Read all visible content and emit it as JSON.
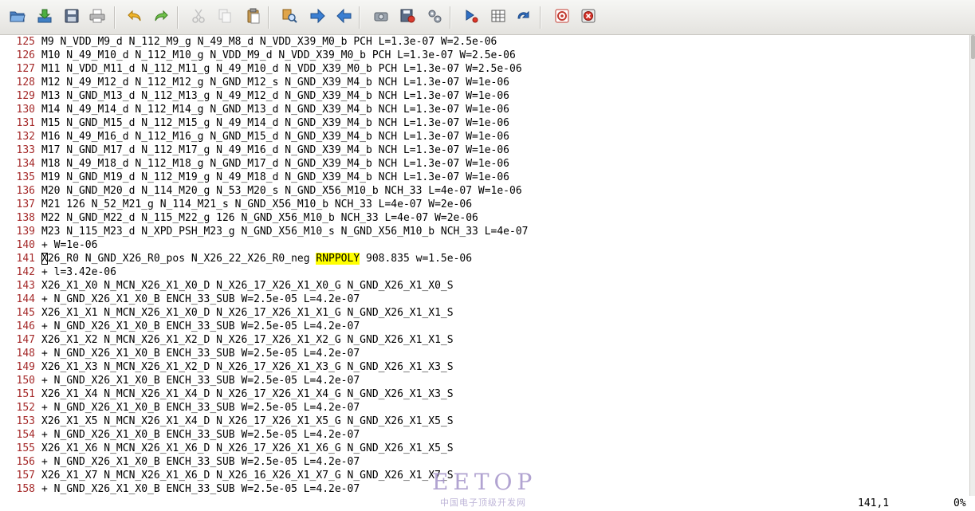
{
  "toolbar": {
    "buttons": [
      {
        "name": "open-folder-icon"
      },
      {
        "name": "download-icon"
      },
      {
        "name": "save-icon"
      },
      {
        "name": "print-icon"
      },
      {
        "name": "undo-icon"
      },
      {
        "name": "redo-icon"
      },
      {
        "name": "cut-icon"
      },
      {
        "name": "copy-icon"
      },
      {
        "name": "paste-icon"
      },
      {
        "name": "find-replace-icon"
      },
      {
        "name": "arrow-right-icon"
      },
      {
        "name": "arrow-left-icon"
      },
      {
        "name": "build-icon"
      },
      {
        "name": "save-session-icon"
      },
      {
        "name": "settings-icon"
      },
      {
        "name": "run-icon"
      },
      {
        "name": "table-icon"
      },
      {
        "name": "redo-arrow-icon"
      },
      {
        "name": "help-icon"
      },
      {
        "name": "close-window-icon"
      }
    ]
  },
  "editor": {
    "lines": [
      {
        "num": "125",
        "text": "M9 N_VDD_M9_d N_112_M9_g N_49_M8_d N_VDD_X39_M0_b PCH L=1.3e-07 W=2.5e-06"
      },
      {
        "num": "126",
        "text": "M10 N_49_M10_d N_112_M10_g N_VDD_M9_d N_VDD_X39_M0_b PCH L=1.3e-07 W=2.5e-06"
      },
      {
        "num": "127",
        "text": "M11 N_VDD_M11_d N_112_M11_g N_49_M10_d N_VDD_X39_M0_b PCH L=1.3e-07 W=2.5e-06"
      },
      {
        "num": "128",
        "text": "M12 N_49_M12_d N_112_M12_g N_GND_M12_s N_GND_X39_M4_b NCH L=1.3e-07 W=1e-06"
      },
      {
        "num": "129",
        "text": "M13 N_GND_M13_d N_112_M13_g N_49_M12_d N_GND_X39_M4_b NCH L=1.3e-07 W=1e-06"
      },
      {
        "num": "130",
        "text": "M14 N_49_M14_d N_112_M14_g N_GND_M13_d N_GND_X39_M4_b NCH L=1.3e-07 W=1e-06"
      },
      {
        "num": "131",
        "text": "M15 N_GND_M15_d N_112_M15_g N_49_M14_d N_GND_X39_M4_b NCH L=1.3e-07 W=1e-06"
      },
      {
        "num": "132",
        "text": "M16 N_49_M16_d N_112_M16_g N_GND_M15_d N_GND_X39_M4_b NCH L=1.3e-07 W=1e-06"
      },
      {
        "num": "133",
        "text": "M17 N_GND_M17_d N_112_M17_g N_49_M16_d N_GND_X39_M4_b NCH L=1.3e-07 W=1e-06"
      },
      {
        "num": "134",
        "text": "M18 N_49_M18_d N_112_M18_g N_GND_M17_d N_GND_X39_M4_b NCH L=1.3e-07 W=1e-06"
      },
      {
        "num": "135",
        "text": "M19 N_GND_M19_d N_112_M19_g N_49_M18_d N_GND_X39_M4_b NCH L=1.3e-07 W=1e-06"
      },
      {
        "num": "136",
        "text": "M20 N_GND_M20_d N_114_M20_g N_53_M20_s N_GND_X56_M10_b NCH_33 L=4e-07 W=1e-06"
      },
      {
        "num": "137",
        "text": "M21 126 N_52_M21_g N_114_M21_s N_GND_X56_M10_b NCH_33 L=4e-07 W=2e-06"
      },
      {
        "num": "138",
        "text": "M22 N_GND_M22_d N_115_M22_g 126 N_GND_X56_M10_b NCH_33 L=4e-07 W=2e-06"
      },
      {
        "num": "139",
        "text": "M23 N_115_M23_d N_XPD_PSH_M23_g N_GND_X56_M10_s N_GND_X56_M10_b NCH_33 L=4e-07"
      },
      {
        "num": "140",
        "text": "+ W=1e-06"
      },
      {
        "num": "141",
        "cursor": "X",
        "text": "26_R0 N_GND_X26_R0_pos N_X26_22_X26_R0_neg ",
        "highlight": "RNPPOLY",
        "after": " 908.835 w=1.5e-06"
      },
      {
        "num": "142",
        "text": "+ l=3.42e-06"
      },
      {
        "num": "143",
        "text": "X26_X1_X0 N_MCN_X26_X1_X0_D N_X26_17_X26_X1_X0_G N_GND_X26_X1_X0_S"
      },
      {
        "num": "144",
        "text": "+ N_GND_X26_X1_X0_B ENCH_33_SUB W=2.5e-05 L=4.2e-07"
      },
      {
        "num": "145",
        "text": "X26_X1_X1 N_MCN_X26_X1_X0_D N_X26_17_X26_X1_X1_G N_GND_X26_X1_X1_S"
      },
      {
        "num": "146",
        "text": "+ N_GND_X26_X1_X0_B ENCH_33_SUB W=2.5e-05 L=4.2e-07"
      },
      {
        "num": "147",
        "text": "X26_X1_X2 N_MCN_X26_X1_X2_D N_X26_17_X26_X1_X2_G N_GND_X26_X1_X1_S"
      },
      {
        "num": "148",
        "text": "+ N_GND_X26_X1_X0_B ENCH_33_SUB W=2.5e-05 L=4.2e-07"
      },
      {
        "num": "149",
        "text": "X26_X1_X3 N_MCN_X26_X1_X2_D N_X26_17_X26_X1_X3_G N_GND_X26_X1_X3_S"
      },
      {
        "num": "150",
        "text": "+ N_GND_X26_X1_X0_B ENCH_33_SUB W=2.5e-05 L=4.2e-07"
      },
      {
        "num": "151",
        "text": "X26_X1_X4 N_MCN_X26_X1_X4_D N_X26_17_X26_X1_X4_G N_GND_X26_X1_X3_S"
      },
      {
        "num": "152",
        "text": "+ N_GND_X26_X1_X0_B ENCH_33_SUB W=2.5e-05 L=4.2e-07"
      },
      {
        "num": "153",
        "text": "X26_X1_X5 N_MCN_X26_X1_X4_D N_X26_17_X26_X1_X5_G N_GND_X26_X1_X5_S"
      },
      {
        "num": "154",
        "text": "+ N_GND_X26_X1_X0_B ENCH_33_SUB W=2.5e-05 L=4.2e-07"
      },
      {
        "num": "155",
        "text": "X26_X1_X6 N_MCN_X26_X1_X6_D N_X26_17_X26_X1_X6_G N_GND_X26_X1_X5_S"
      },
      {
        "num": "156",
        "text": "+ N_GND_X26_X1_X0_B ENCH_33_SUB W=2.5e-05 L=4.2e-07"
      },
      {
        "num": "157",
        "text": "X26_X1_X7 N_MCN_X26_X1_X6_D N_X26_16_X26_X1_X7_G N_GND_X26_X1_X7_S"
      },
      {
        "num": "158",
        "text": "+ N_GND_X26_X1_X0_B ENCH_33_SUB W=2.5e-05 L=4.2e-07"
      }
    ]
  },
  "status": {
    "position": "141,1",
    "percent": "0%"
  },
  "watermark": {
    "brand": "EETOP",
    "tagline": "中国电子顶级开发网"
  }
}
